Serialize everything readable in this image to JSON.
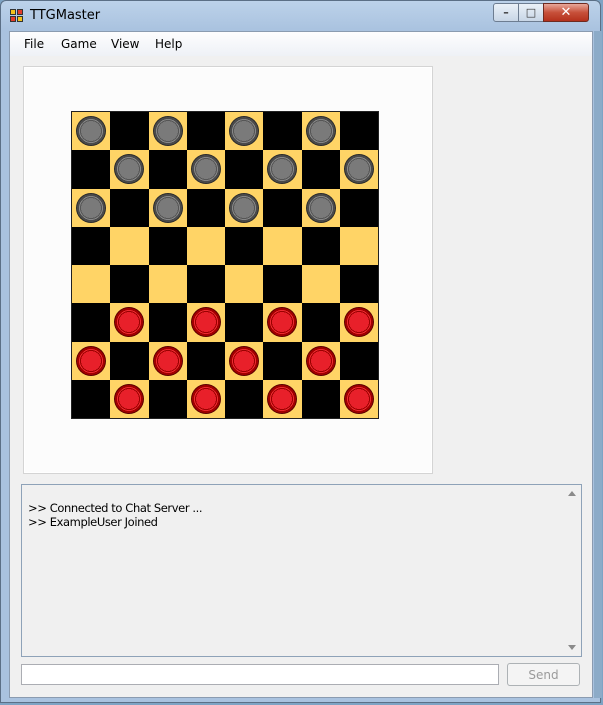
{
  "window": {
    "title": "TTGMaster",
    "controls": {
      "minimize": "–",
      "maximize": "□",
      "close": "✕"
    }
  },
  "menu": {
    "items": [
      {
        "label": "File"
      },
      {
        "label": "Game"
      },
      {
        "label": "View"
      },
      {
        "label": "Help"
      }
    ]
  },
  "board": {
    "light_color": "#ffd466",
    "dark_color": "#000000",
    "pieces": [
      {
        "row": 0,
        "col": 0,
        "color": "gray"
      },
      {
        "row": 0,
        "col": 2,
        "color": "gray"
      },
      {
        "row": 0,
        "col": 4,
        "color": "gray"
      },
      {
        "row": 0,
        "col": 6,
        "color": "gray"
      },
      {
        "row": 1,
        "col": 1,
        "color": "gray"
      },
      {
        "row": 1,
        "col": 3,
        "color": "gray"
      },
      {
        "row": 1,
        "col": 5,
        "color": "gray"
      },
      {
        "row": 1,
        "col": 7,
        "color": "gray"
      },
      {
        "row": 2,
        "col": 0,
        "color": "gray"
      },
      {
        "row": 2,
        "col": 2,
        "color": "gray"
      },
      {
        "row": 2,
        "col": 4,
        "color": "gray"
      },
      {
        "row": 2,
        "col": 6,
        "color": "gray"
      },
      {
        "row": 5,
        "col": 1,
        "color": "red"
      },
      {
        "row": 5,
        "col": 3,
        "color": "red"
      },
      {
        "row": 5,
        "col": 5,
        "color": "red"
      },
      {
        "row": 5,
        "col": 7,
        "color": "red"
      },
      {
        "row": 6,
        "col": 0,
        "color": "red"
      },
      {
        "row": 6,
        "col": 2,
        "color": "red"
      },
      {
        "row": 6,
        "col": 4,
        "color": "red"
      },
      {
        "row": 6,
        "col": 6,
        "color": "red"
      },
      {
        "row": 7,
        "col": 1,
        "color": "red"
      },
      {
        "row": 7,
        "col": 3,
        "color": "red"
      },
      {
        "row": 7,
        "col": 5,
        "color": "red"
      },
      {
        "row": 7,
        "col": 7,
        "color": "red"
      }
    ]
  },
  "chat": {
    "lines": [
      ">> Connected to Chat Server ...",
      ">> ExampleUser Joined"
    ],
    "input_value": "",
    "send_label": "Send"
  }
}
